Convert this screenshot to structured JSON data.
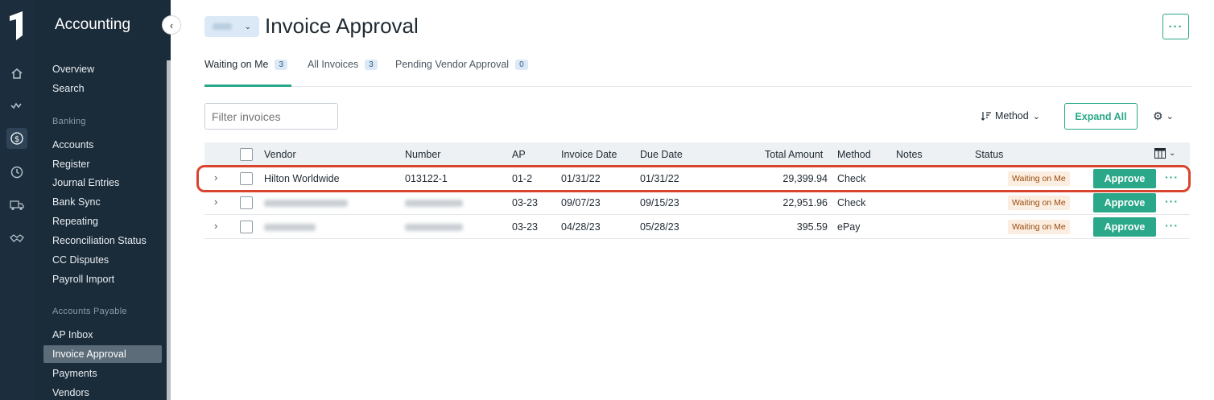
{
  "nav": {
    "title": "Accounting",
    "groups": [
      {
        "section": "",
        "items": [
          "Overview",
          "Search"
        ]
      },
      {
        "section": "Banking",
        "items": [
          "Accounts",
          "Register",
          "Journal Entries",
          "Bank Sync",
          "Repeating",
          "Reconciliation Status",
          "CC Disputes",
          "Payroll Import"
        ]
      },
      {
        "section": "Accounts Payable",
        "items": [
          "AP Inbox",
          "Invoice Approval",
          "Payments",
          "Vendors"
        ]
      }
    ],
    "selected": "Invoice Approval"
  },
  "header": {
    "title": "Invoice Approval",
    "more_label": "···"
  },
  "tabs": [
    {
      "label": "Waiting on Me",
      "count": "3",
      "active": true
    },
    {
      "label": "All Invoices",
      "count": "3",
      "active": false
    },
    {
      "label": "Pending Vendor Approval",
      "count": "0",
      "active": false
    }
  ],
  "toolbar": {
    "filter_placeholder": "Filter invoices",
    "sort_label": "Method",
    "expand_label": "Expand All"
  },
  "table": {
    "columns": [
      "Vendor",
      "Number",
      "AP",
      "Invoice Date",
      "Due Date",
      "Total Amount",
      "Method",
      "Notes",
      "Status"
    ],
    "rows": [
      {
        "vendor": "Hilton Worldwide",
        "number": "013122-1",
        "ap": "01-2",
        "invoice_date": "01/31/22",
        "due_date": "01/31/22",
        "total": "29,399.94",
        "method": "Check",
        "notes": "",
        "status": "Waiting on Me",
        "action": "Approve"
      },
      {
        "vendor": "",
        "number": "",
        "ap": "03-23",
        "invoice_date": "09/07/23",
        "due_date": "09/15/23",
        "total": "22,951.96",
        "method": "Check",
        "notes": "",
        "status": "Waiting on Me",
        "action": "Approve"
      },
      {
        "vendor": "",
        "number": "",
        "ap": "03-23",
        "invoice_date": "04/28/23",
        "due_date": "05/28/23",
        "total": "395.59",
        "method": "ePay",
        "notes": "",
        "status": "Waiting on Me",
        "action": "Approve"
      }
    ]
  },
  "icons": [
    "home-icon",
    "activity-icon",
    "dollar-icon",
    "clock-icon",
    "truck-icon",
    "handshake-icon"
  ],
  "colors": {
    "accent": "#2aa889",
    "sidebar": "#1a2b39",
    "highlight": "#d9442e",
    "status_bg": "#fbeee0"
  }
}
